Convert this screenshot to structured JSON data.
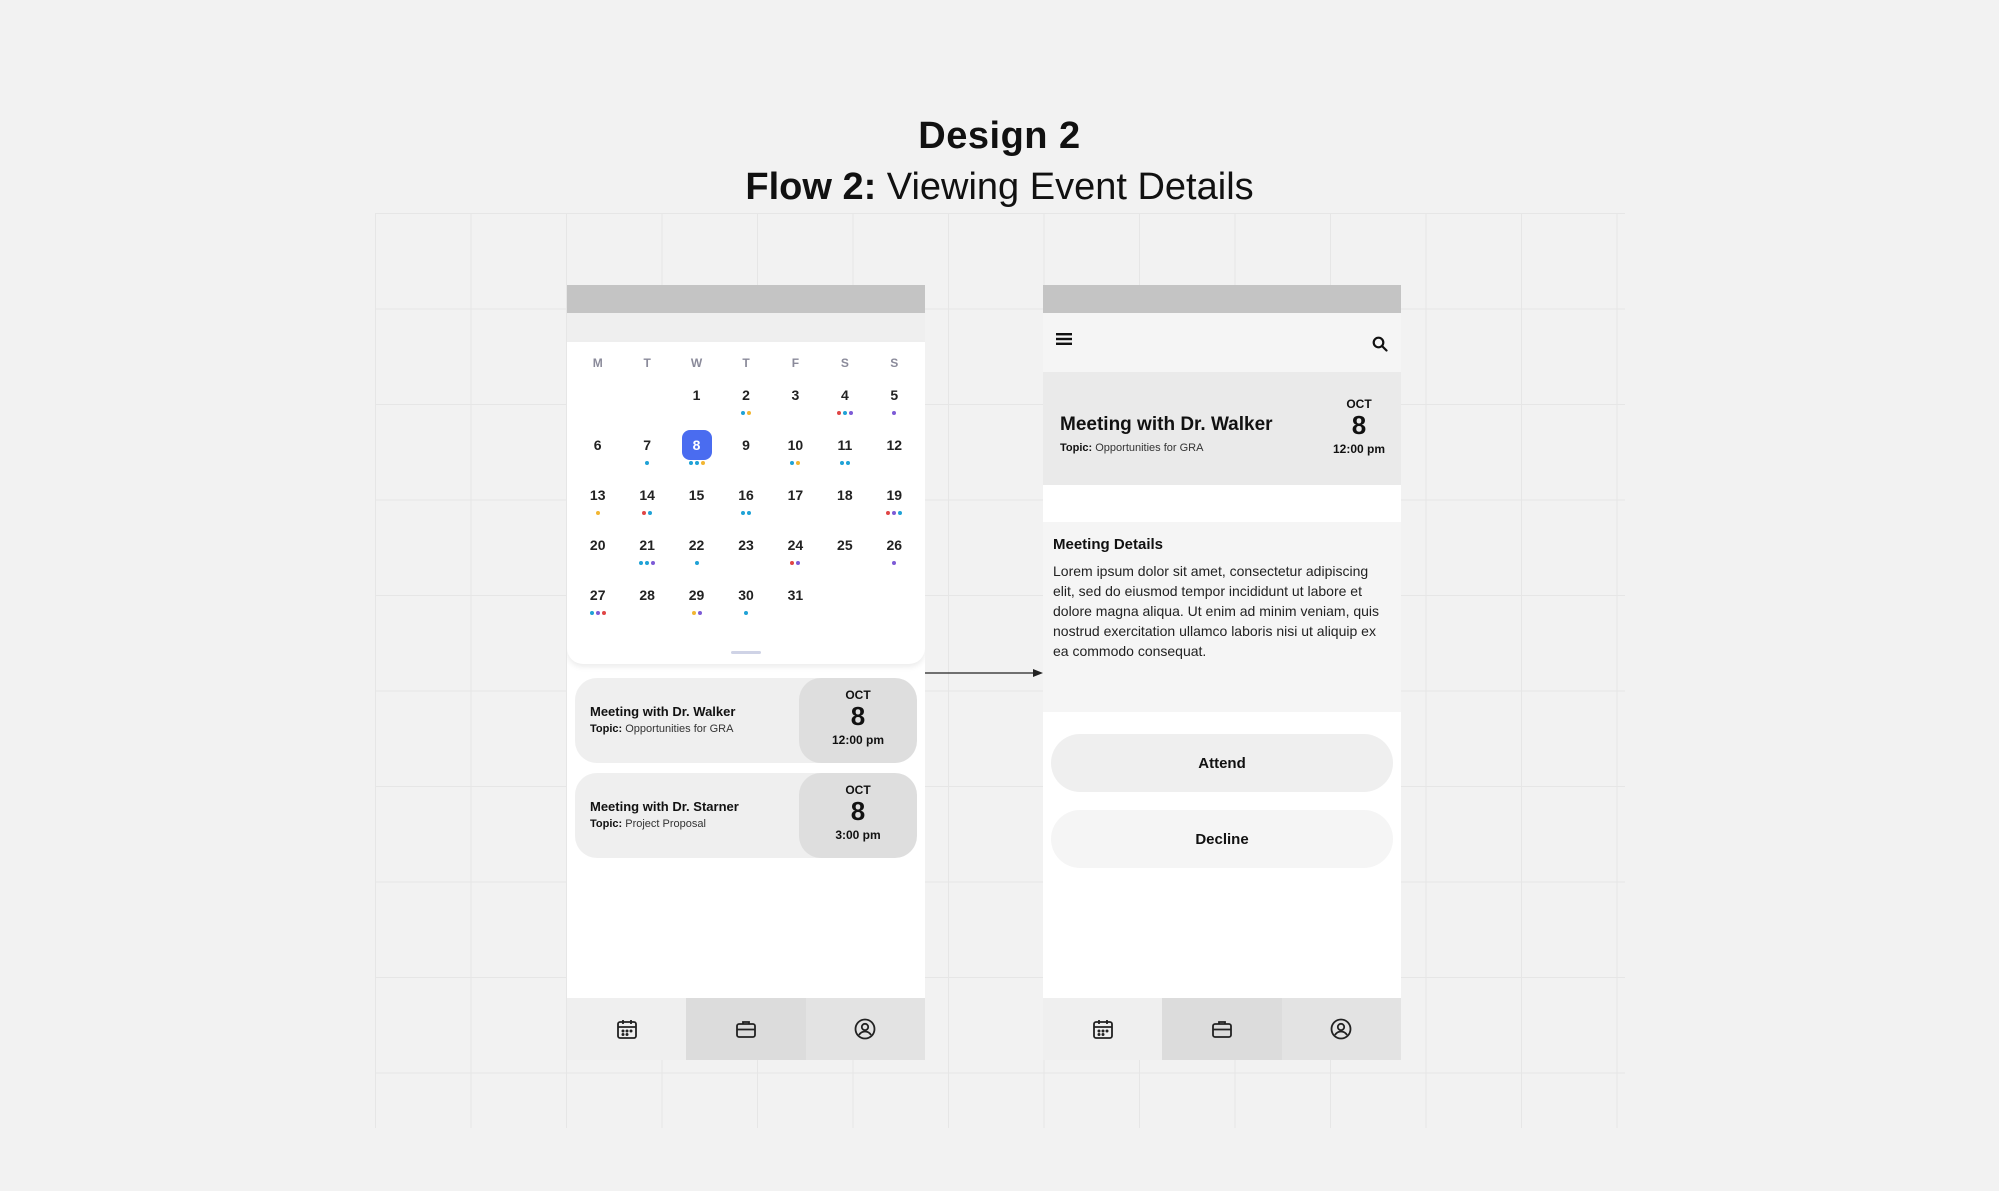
{
  "title": {
    "line1": "Design 2",
    "flow_label": "Flow 2:",
    "flow_name": " Viewing Event Details"
  },
  "calendar": {
    "weekdays": [
      "M",
      "T",
      "W",
      "T",
      "F",
      "S",
      "S"
    ],
    "selected_day": "8",
    "weeks": [
      [
        {
          "d": ""
        },
        {
          "d": ""
        },
        {
          "d": "1"
        },
        {
          "d": "2",
          "dots": [
            "#1fa2d6",
            "#f2b632"
          ]
        },
        {
          "d": "3"
        },
        {
          "d": "4",
          "dots": [
            "#e04545",
            "#1fa2d6",
            "#7d5bd6"
          ]
        },
        {
          "d": "5",
          "dots": [
            "#7d5bd6"
          ]
        }
      ],
      [
        {
          "d": "6"
        },
        {
          "d": "7",
          "dots": [
            "#1fa2d6"
          ]
        },
        {
          "d": "8",
          "dots": [
            "#1fa2d6",
            "#1fa2d6",
            "#f2b632"
          ]
        },
        {
          "d": "9"
        },
        {
          "d": "10",
          "dots": [
            "#1fa2d6",
            "#f2b632"
          ]
        },
        {
          "d": "11",
          "dots": [
            "#1fa2d6",
            "#1fa2d6"
          ]
        },
        {
          "d": "12"
        }
      ],
      [
        {
          "d": "13",
          "dots": [
            "#f2b632"
          ]
        },
        {
          "d": "14",
          "dots": [
            "#e04545",
            "#1fa2d6"
          ]
        },
        {
          "d": "15"
        },
        {
          "d": "16",
          "dots": [
            "#1fa2d6",
            "#1fa2d6"
          ]
        },
        {
          "d": "17"
        },
        {
          "d": "18"
        },
        {
          "d": "19",
          "dots": [
            "#e04545",
            "#7d5bd6",
            "#1fa2d6"
          ]
        }
      ],
      [
        {
          "d": "20"
        },
        {
          "d": "21",
          "dots": [
            "#1fa2d6",
            "#1fa2d6",
            "#7d5bd6"
          ]
        },
        {
          "d": "22",
          "dots": [
            "#1fa2d6"
          ]
        },
        {
          "d": "23"
        },
        {
          "d": "24",
          "dots": [
            "#e04545",
            "#7d5bd6"
          ]
        },
        {
          "d": "25"
        },
        {
          "d": "26",
          "dots": [
            "#7d5bd6"
          ]
        }
      ],
      [
        {
          "d": "27",
          "dots": [
            "#1fa2d6",
            "#7d5bd6",
            "#e04545"
          ]
        },
        {
          "d": "28"
        },
        {
          "d": "29",
          "dots": [
            "#f2b632",
            "#7d5bd6"
          ]
        },
        {
          "d": "30",
          "dots": [
            "#1fa2d6"
          ]
        },
        {
          "d": "31"
        },
        {
          "d": ""
        },
        {
          "d": ""
        }
      ]
    ]
  },
  "events": [
    {
      "title": "Meeting with Dr. Walker",
      "topic_label": "Topic:",
      "topic": " Opportunities for GRA",
      "month": "OCT",
      "day": "8",
      "time": "12:00 pm"
    },
    {
      "title": "Meeting with Dr. Starner",
      "topic_label": "Topic:",
      "topic": " Project Proposal",
      "month": "OCT",
      "day": "8",
      "time": "3:00 pm"
    }
  ],
  "detail": {
    "title": "Meeting with Dr. Walker",
    "topic_label": "Topic:",
    "topic": " Opportunities for GRA",
    "month": "OCT",
    "day": "8",
    "time": "12:00 pm",
    "section_heading": "Meeting Details",
    "body": "Lorem ipsum dolor sit amet, consectetur adipiscing elit, sed do eiusmod tempor incididunt ut labore et dolore magna aliqua. Ut enim ad minim veniam, quis nostrud exercitation ullamco laboris nisi ut aliquip ex ea commodo consequat.",
    "attend_label": "Attend",
    "decline_label": "Decline"
  },
  "icons": {
    "menu": "hamburger-menu-icon",
    "search": "search-icon",
    "nav": [
      "calendar-icon",
      "briefcase-icon",
      "profile-icon"
    ]
  },
  "colors": {
    "selected_day": "#4a6cf0",
    "background": "#f2f2f2"
  }
}
